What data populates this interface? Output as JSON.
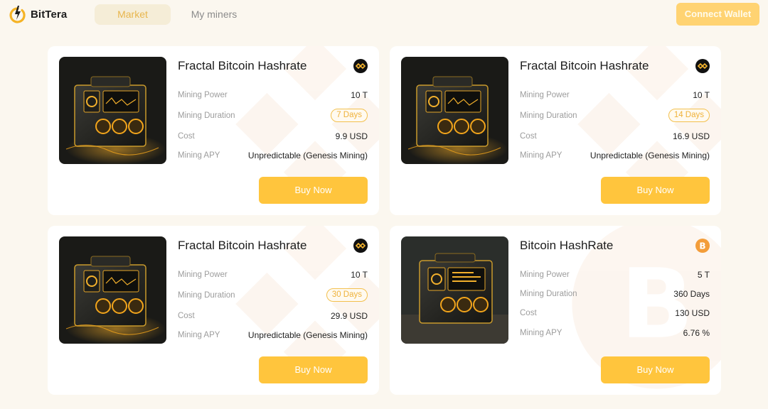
{
  "header": {
    "brand": "BitTera",
    "tabs": [
      {
        "label": "Market",
        "active": true
      },
      {
        "label": "My miners",
        "active": false
      }
    ],
    "connect_label": "Connect Wallet"
  },
  "colors": {
    "accent": "#ffc53d",
    "accent_light": "#ffd372",
    "background": "#fbf7ef",
    "pill_border": "#f3c04d"
  },
  "cards": [
    {
      "title": "Fractal Bitcoin Hashrate",
      "coin_icon": "fractal-icon",
      "rows": [
        {
          "label": "Mining Power",
          "value": "10 T"
        },
        {
          "label": "Mining Duration",
          "value": "7 Days"
        },
        {
          "label": "Cost",
          "value": "9.9 USD"
        },
        {
          "label": "Mining APY",
          "value": "Unpredictable (Genesis Mining)"
        }
      ],
      "button": "Buy Now"
    },
    {
      "title": "Fractal Bitcoin Hashrate",
      "coin_icon": "fractal-icon",
      "rows": [
        {
          "label": "Mining Power",
          "value": "10 T"
        },
        {
          "label": "Mining Duration",
          "value": "14 Days"
        },
        {
          "label": "Cost",
          "value": "16.9 USD"
        },
        {
          "label": "Mining APY",
          "value": "Unpredictable (Genesis Mining)"
        }
      ],
      "button": "Buy Now"
    },
    {
      "title": "Fractal Bitcoin Hashrate",
      "coin_icon": "fractal-icon",
      "rows": [
        {
          "label": "Mining Power",
          "value": "10 T"
        },
        {
          "label": "Mining Duration",
          "value": "30 Days"
        },
        {
          "label": "Cost",
          "value": "29.9 USD"
        },
        {
          "label": "Mining APY",
          "value": "Unpredictable (Genesis Mining)"
        }
      ],
      "button": "Buy Now"
    },
    {
      "title": "Bitcoin HashRate",
      "coin_icon": "bitcoin-icon",
      "rows": [
        {
          "label": "Mining Power",
          "value": "5 T"
        },
        {
          "label": "Mining Duration",
          "value": "360 Days"
        },
        {
          "label": "Cost",
          "value": "130 USD"
        },
        {
          "label": "Mining APY",
          "value": "6.76 %"
        }
      ],
      "button": "Buy Now"
    }
  ]
}
